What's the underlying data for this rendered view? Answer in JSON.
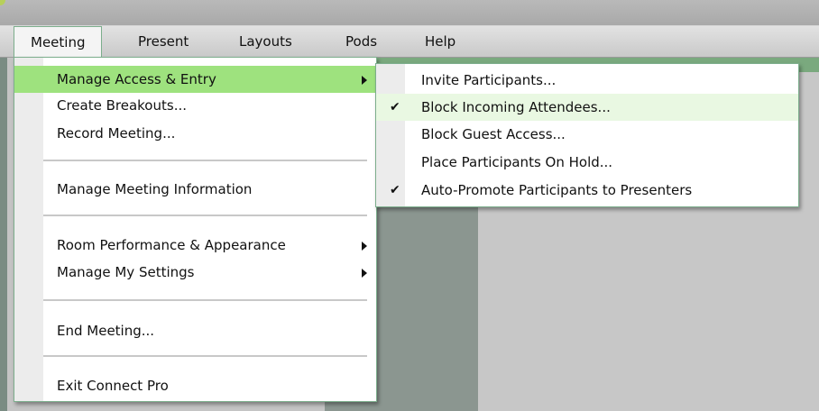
{
  "menubar": {
    "items": [
      "Meeting",
      "Present",
      "Layouts",
      "Pods",
      "Help"
    ]
  },
  "meeting_menu": {
    "items": [
      {
        "label": "Manage Access & Entry",
        "submenu": true
      },
      {
        "label": "Create Breakouts..."
      },
      {
        "label": "Record Meeting..."
      },
      {
        "label": "Manage Meeting Information"
      },
      {
        "label": "Room Performance & Appearance",
        "submenu": true
      },
      {
        "label": "Manage My Settings",
        "submenu": true
      },
      {
        "label": "End Meeting..."
      },
      {
        "label": "Exit Connect Pro"
      }
    ]
  },
  "access_submenu": {
    "items": [
      {
        "label": "Invite Participants...",
        "checked": false
      },
      {
        "label": "Block Incoming Attendees...",
        "checked": true
      },
      {
        "label": "Block Guest Access...",
        "checked": false
      },
      {
        "label": "Place Participants On Hold...",
        "checked": false
      },
      {
        "label": "Auto-Promote Participants to Presenters",
        "checked": true
      }
    ],
    "check_glyph": "✔"
  },
  "colors": {
    "highlight": "#9ee27e",
    "menu_border": "#7cae8c"
  }
}
